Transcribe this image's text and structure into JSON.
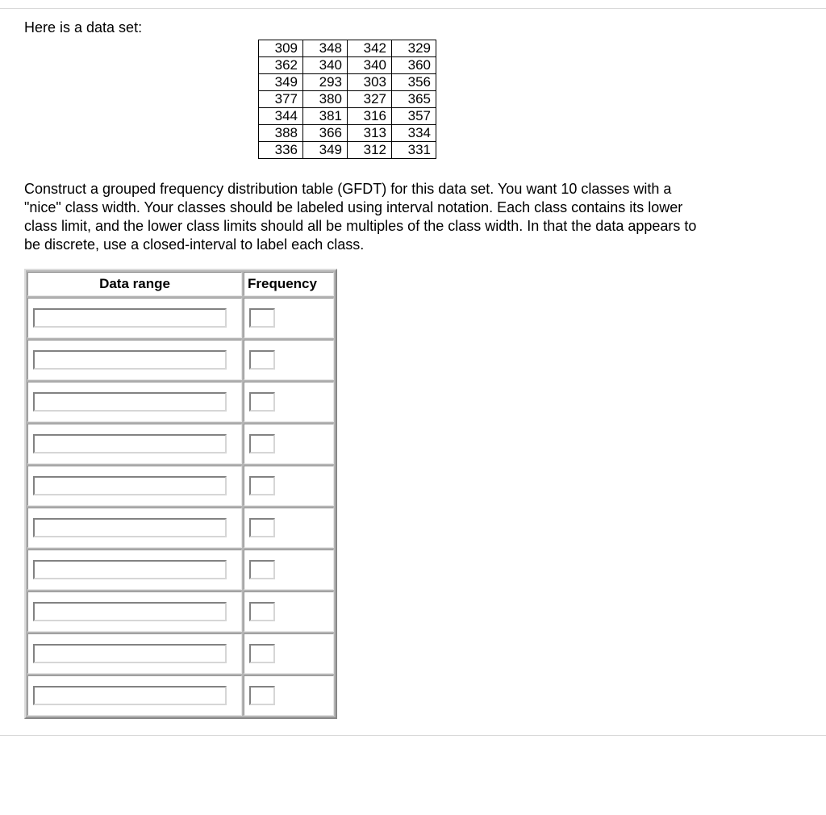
{
  "intro_text": "Here is a data set:",
  "data_rows": [
    [
      "309",
      "348",
      "342",
      "329"
    ],
    [
      "362",
      "340",
      "340",
      "360"
    ],
    [
      "349",
      "293",
      "303",
      "356"
    ],
    [
      "377",
      "380",
      "327",
      "365"
    ],
    [
      "344",
      "381",
      "316",
      "357"
    ],
    [
      "388",
      "366",
      "313",
      "334"
    ],
    [
      "336",
      "349",
      "312",
      "331"
    ]
  ],
  "instructions_text": "Construct a grouped frequency distribution table (GFDT) for this data set. You want 10 classes with a \"nice\" class width. Your classes should be labeled using interval notation. Each class contains its lower class limit, and the lower class limits should all be multiples of the class width. In that the data appears to be discrete, use a closed-interval to label each class.",
  "gfdt": {
    "headers": {
      "range": "Data range",
      "frequency": "Frequency"
    },
    "num_rows": 10,
    "rows": [
      {
        "range": "",
        "freq": ""
      },
      {
        "range": "",
        "freq": ""
      },
      {
        "range": "",
        "freq": ""
      },
      {
        "range": "",
        "freq": ""
      },
      {
        "range": "",
        "freq": ""
      },
      {
        "range": "",
        "freq": ""
      },
      {
        "range": "",
        "freq": ""
      },
      {
        "range": "",
        "freq": ""
      },
      {
        "range": "",
        "freq": ""
      },
      {
        "range": "",
        "freq": ""
      }
    ]
  }
}
